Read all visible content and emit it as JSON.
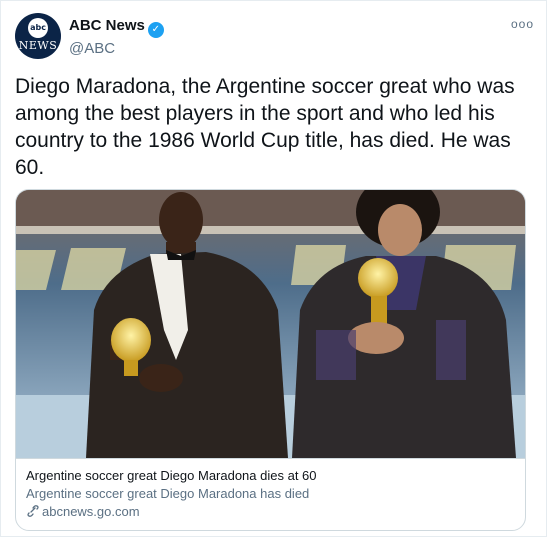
{
  "account": {
    "display_name": "ABC News",
    "handle": "@ABC",
    "avatar_logo_text": "abc",
    "avatar_sub_text": "NEWS",
    "verified_icon": "verified-badge-icon"
  },
  "more_icon": "more-options-icon",
  "tweet": {
    "text": "Diego Maradona, the Argentine soccer great who was among the best players in the sport and who led his country to the 1986 World Cup title, has died. He was 60."
  },
  "card": {
    "image_description_icon": "photo",
    "title": "Argentine soccer great Diego Maradona dies at 60",
    "description": "Argentine soccer great Diego Maradona has died",
    "domain": "abcnews.go.com",
    "domain_icon": "link-icon"
  },
  "colors": {
    "accent": "#1da1f2",
    "secondary_text": "#5b7083",
    "border": "#cfd9de"
  }
}
